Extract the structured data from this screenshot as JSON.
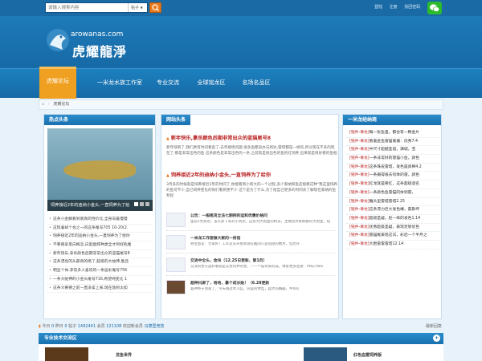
{
  "topbar": {
    "search_placeholder": "请输入搜索内容",
    "search_type": "帖子",
    "links": [
      "登陆",
      "注册",
      "找回密码"
    ]
  },
  "header": {
    "domain": "arowanas.com",
    "site_name": "虎耀龍淨"
  },
  "nav": {
    "items": [
      "虎耀论坛",
      "一米龙水族工作室",
      "专业交流",
      "全球铭龙区",
      "名场名品区"
    ],
    "active_index": 0
  },
  "breadcrumb": {
    "current": "虎耀论坛"
  },
  "hot": {
    "title": "热点头条",
    "caption": "饲养接近2年的迪纳小金头,一直饲养为了给",
    "list": [
      "这条小金鳞看到底真的性价比,全身向着慢慢",
      "这现着却个会之一的这条尾号705 10-20(2.",
      "饲养接近2年的迪纳小金头,一直饲养为了给你",
      "不要再拿黑白概念,白起能辉种类全才到好危尾",
      "新年快乐,拿杀颜色后期非常出众的蓝猫尾号8",
      "这条漂亮的头部真的绝了,超级的大帕伸,胜且",
      "明显个体,李常多人喜欢的一条迪彩尾号756",
      "一条大帕伸的小金头尾号716,希望纯变化 1",
      "这条大赛要之前一直没拿上来,现在放到太如"
    ]
  },
  "news": {
    "title": "网站头条",
    "headlines": [
      {
        "title": "新年快乐,拿杀颜色后期非常出众的蓝猫尾号8",
        "summary": "新年快到了,我们更有时间看鱼了,去年接情问题,很多鱼都没办法到达,雷塔都是一样的,所以现在不多的现在了,那是非常出色的鱼 这条颜色是非常出色的一条,之前就是很出色的鱼的红饲养,出来就是很好看的鱼框"
      },
      {
        "title": "饲养接近2年的迪纳小金头,一直饲养为了给你",
        "summary": "3月多的时候就是饲养接近2年的时间了,你能看到小到大的一个过程,多少渐纳和鱼店能教这种\"我这里饲养的鱼可不少,自己饲养变化的你们看到更不少 这个是为了什么,为了给自己更多的时间去了解现在渐纳的鱼和控"
      }
    ],
    "threads": [
      {
        "title": "公告：一般尾货立法七期例的运和优惠价格问",
        "desc": "鱼前1文到达，该头部下来对于到达，这份为大把鱼的附货，主要因为每如都有大把鱼，短"
      },
      {
        "title": "一米龙工作室做大家的一封信",
        "desc": "各位鱼友：大家好！工作室从开张到现在截间只是短短的数月，但也许"
      },
      {
        "title": "交流中全头，金块（12.25日更新，第1页）",
        "desc": "交流的金头是好看就是实金得界的金，——个成块来形成，博客更多连接：http://bla"
      },
      {
        "title": "超神抖屏了，哈哈，暴个成长贴！（6.28更新",
        "desc": "超神终于到家了，今天刚过水入缸，完美的体型，超大的胸器，牛X的"
      }
    ]
  },
  "right": {
    "title": "一米龙经纳商",
    "items": [
      {
        "tag": "[铭件-尊龙]",
        "text": "每一张鱼里，都会有一颗金片"
      },
      {
        "tag": "[铭件-尊龙]",
        "text": "看着金鱼雷猫尾偏：优秀7.4"
      },
      {
        "tag": "[铭件-尊龙]",
        "text": "中尺寸超越圣诞，满城，宝"
      },
      {
        "tag": "[铭件-尊龙]",
        "text": "一条非常好的雷猫小鱼，颜色"
      },
      {
        "tag": "[铭件-尊龙]",
        "text": "这条珠皮雷塔，发色是真稀4.2"
      },
      {
        "tag": "[铭件-尊龙]",
        "text": "一条摄得很去何季的雷，颜色"
      },
      {
        "tag": "[铭件-尊龙]",
        "text": "红龙就是要红，这条超级适名"
      },
      {
        "tag": "[铭件-尊龙]",
        "text": "一条颜色鱼雷猫的体到雷，"
      },
      {
        "tag": "[铭件-尊龙]",
        "text": "雕头型雷塔雷塔2.25"
      },
      {
        "tag": "[铭件-尊龙]",
        "text": "这条漂力巨大发色端，震斯坪"
      },
      {
        "tag": "[铭件-尊龙]",
        "text": "超级圣疑，赵一样的发色1.14"
      },
      {
        "tag": "[铭件-尊龙]",
        "text": "优秀超级圣疑，表现足够优色"
      },
      {
        "tag": "[铭件-尊龙]",
        "text": "雷猫尾表现这试，彩后一个半月之"
      },
      {
        "tag": "[铭件-尊龙]",
        "text": "大胎雷雷雷塔12.14"
      }
    ]
  },
  "stats": {
    "today_label": "今日",
    "today": "0",
    "yesterday_label": "昨日",
    "yesterday": "0",
    "posts_label": "帖子",
    "posts": "1492441",
    "members_label": "会员",
    "members": "121108",
    "newest_label": "欢迎新会员",
    "newest": "马德里竞技",
    "recent_label": "最新回复"
  },
  "bottom": {
    "title": "专业技术交流区",
    "more": "+",
    "cards": [
      "龙鱼世界",
      "红色血雷饲养版"
    ]
  },
  "colors": {
    "primary": "#1a6aa6",
    "accent": "#f0a020",
    "headline": "#b81f1f"
  }
}
